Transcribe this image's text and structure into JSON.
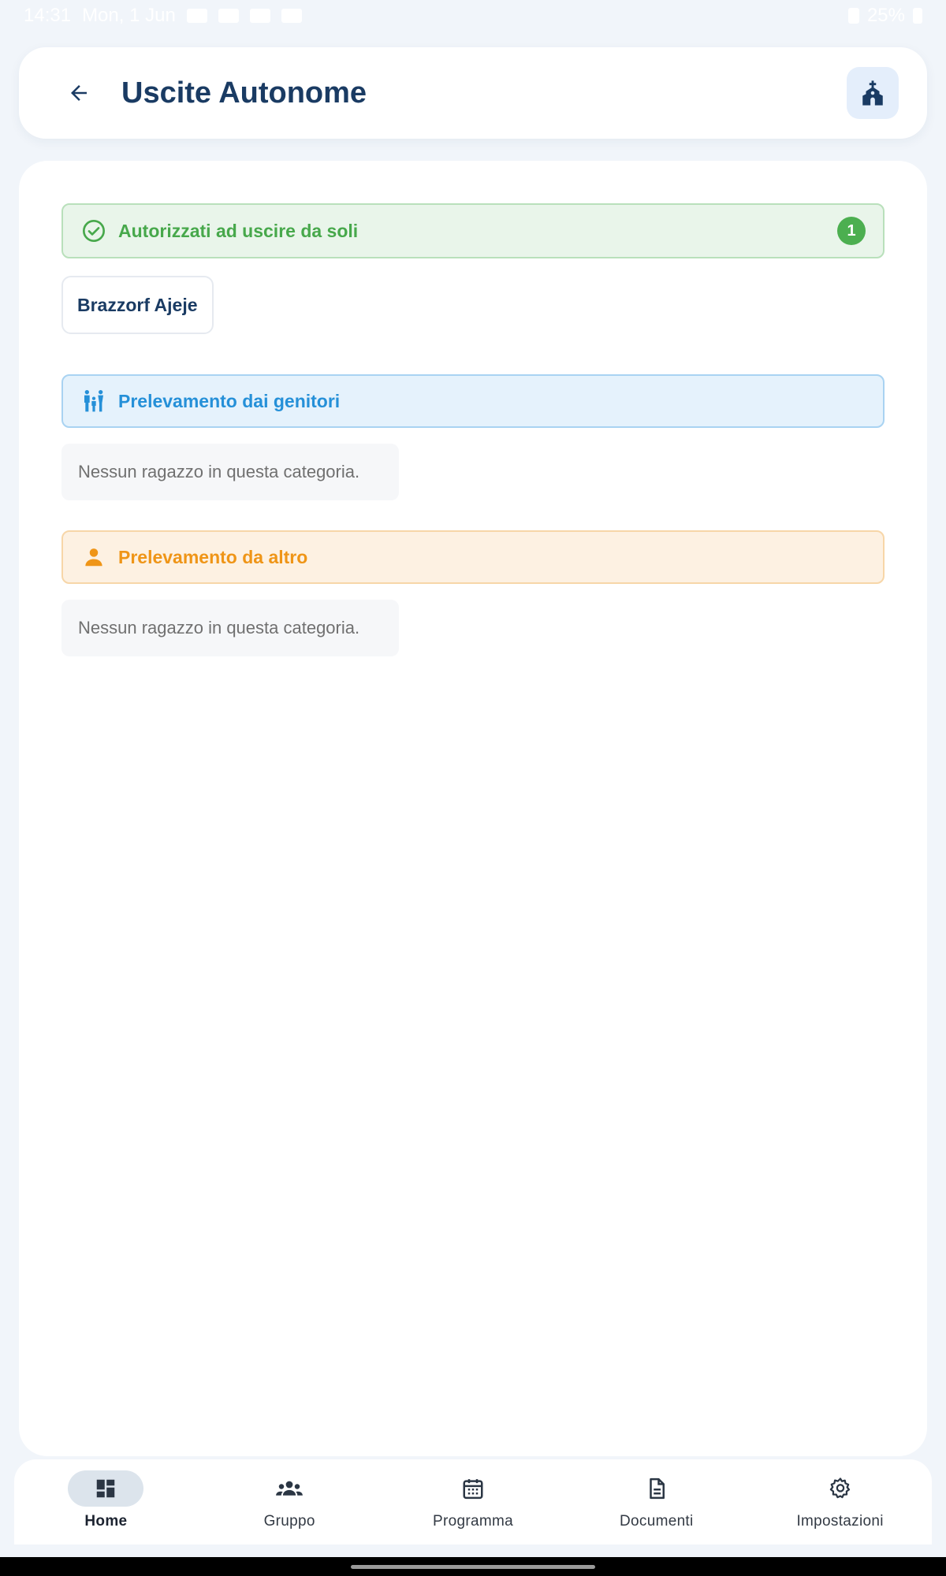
{
  "status_bar": {
    "time": "14:31",
    "date": "Mon, 1 Jun",
    "battery": "25%"
  },
  "app_bar": {
    "title": "Uscite Autonome",
    "back_icon": "arrow-left-icon",
    "action_icon": "church-icon"
  },
  "sections": [
    {
      "label": "Autorizzati ad uscire da soli",
      "icon": "check-circle-icon",
      "color": "#47a84b",
      "count": "1",
      "members": [
        "Brazzorf Ajeje"
      ]
    },
    {
      "label": "Prelevamento dai genitori",
      "icon": "family-icon",
      "color": "#2590d8",
      "empty_text": "Nessun ragazzo in questa categoria."
    },
    {
      "label": "Prelevamento da altro",
      "icon": "person-icon",
      "color": "#ef9517",
      "empty_text": "Nessun ragazzo in questa categoria."
    }
  ],
  "bottom_nav": {
    "active": "Home",
    "items": [
      {
        "label": "Home",
        "icon": "dashboard-icon"
      },
      {
        "label": "Gruppo",
        "icon": "group-icon"
      },
      {
        "label": "Programma",
        "icon": "calendar-icon"
      },
      {
        "label": "Documenti",
        "icon": "document-icon"
      },
      {
        "label": "Impostazioni",
        "icon": "gear-icon"
      }
    ]
  },
  "colors": {
    "primary": "#1a3b63",
    "background": "#f1f5fa",
    "surface": "#ffffff",
    "success": "#4caf50"
  }
}
